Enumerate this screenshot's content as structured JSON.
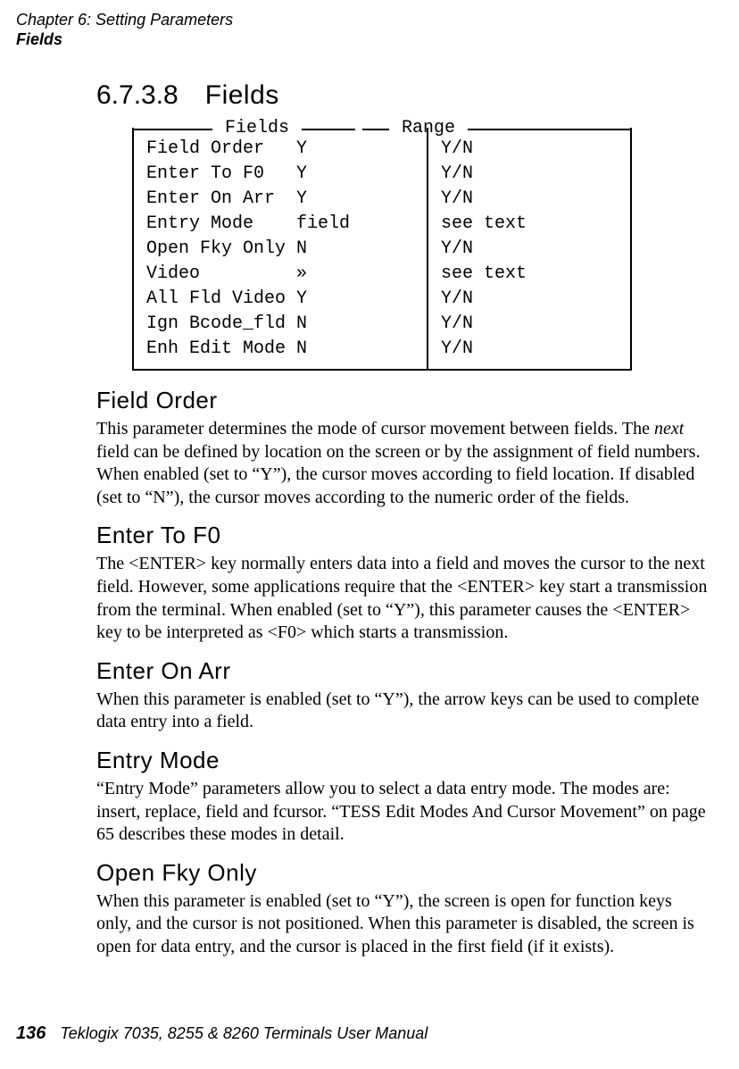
{
  "header": {
    "line1": "Chapter 6: Setting Parameters",
    "line2": "Fields"
  },
  "section": {
    "number": "6.7.3.8",
    "title": "Fields"
  },
  "diagram": {
    "title_left": "Fields",
    "title_right": "Range",
    "rows": [
      {
        "label": "Field Order",
        "value": "Y",
        "range": "Y/N"
      },
      {
        "label": "Enter To F0",
        "value": "Y",
        "range": "Y/N"
      },
      {
        "label": "Enter On Arr",
        "value": "Y",
        "range": "Y/N"
      },
      {
        "label": "Entry Mode",
        "value": "field",
        "range": "see text"
      },
      {
        "label": "Open Fky Only",
        "value": "N",
        "range": "Y/N"
      },
      {
        "label": "Video",
        "value": "»",
        "range": "see text"
      },
      {
        "label": "All Fld Video",
        "value": "Y",
        "range": "Y/N"
      },
      {
        "label": "Ign Bcode_fld",
        "value": "N",
        "range": "Y/N"
      },
      {
        "label": "Enh Edit Mode",
        "value": "N",
        "range": "Y/N"
      }
    ]
  },
  "sections": {
    "field_order": {
      "title": "Field Order",
      "p1a": "This parameter determines the mode of cursor movement between fields. The ",
      "p1em": "next",
      "p1b": " field can be defined by location on the screen or by the assignment of field numbers. When enabled (set to “Y”), the cursor moves according to field location. If disabled (set to “N”), the cursor moves according to the numeric order of the fields."
    },
    "enter_to_f0": {
      "title": "Enter To F0",
      "p": "The <ENTER> key normally enters data into a field and moves the cursor to the next field. However, some applications require that the <ENTER> key start a transmission from the terminal. When enabled (set to “Y”), this parameter causes the <ENTER> key to be interpreted as <F0> which starts a transmission."
    },
    "enter_on_arr": {
      "title": "Enter On Arr",
      "p": "When this parameter is enabled (set to “Y”), the arrow keys can be used to complete data entry into a field."
    },
    "entry_mode": {
      "title": "Entry Mode",
      "p": "“Entry Mode” parameters allow you to select a data entry mode. The modes are: insert, replace, field and fcursor. “TESS Edit Modes And Cursor Movement” on page 65 describes these modes in detail."
    },
    "open_fky_only": {
      "title": "Open Fky Only",
      "p": "When this parameter is enabled (set to “Y”), the screen is open for function keys only, and the cursor is not positioned. When this parameter is disabled, the screen is open for data entry, and the cursor is placed in the first field (if it exists)."
    }
  },
  "footer": {
    "page_number": "136",
    "manual": "Teklogix 7035, 8255 & 8260 Terminals User Manual"
  }
}
